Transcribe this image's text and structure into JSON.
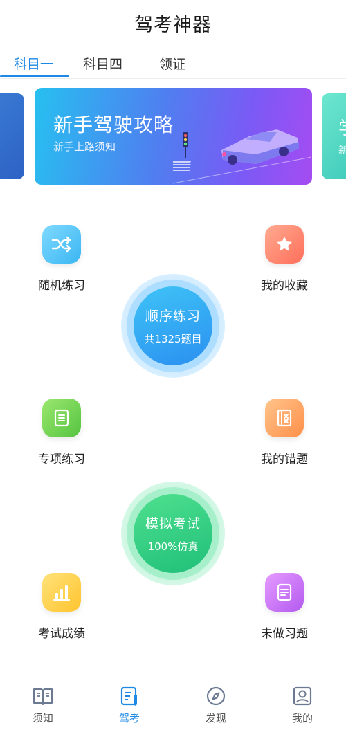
{
  "header": {
    "title": "驾考神器"
  },
  "tabs": [
    {
      "label": "科目一",
      "active": true
    },
    {
      "label": "科目四",
      "active": false
    },
    {
      "label": "领证",
      "active": false
    }
  ],
  "banner": {
    "title": "新手驾驶攻略",
    "subtitle": "新手上路须知",
    "next_peek_title": "学",
    "next_peek_subtitle": "新"
  },
  "features": {
    "random_practice": {
      "label": "随机练习",
      "icon": "shuffle-icon",
      "color": "#4fc3f7"
    },
    "my_favorites": {
      "label": "我的收藏",
      "icon": "star-icon",
      "color": "#ff8a65"
    },
    "topic_practice": {
      "label": "专项练习",
      "icon": "scroll-list-icon",
      "color": "#7ed957"
    },
    "my_mistakes": {
      "label": "我的错题",
      "icon": "mistake-book-icon",
      "color": "#ffa26b"
    },
    "exam_scores": {
      "label": "考试成绩",
      "icon": "bar-chart-icon",
      "color": "#ffd54f"
    },
    "undone_questions": {
      "label": "未做习题",
      "icon": "document-icon",
      "color": "#c06cf0"
    }
  },
  "sequential_practice": {
    "title": "顺序练习",
    "subtitle": "共1325题目"
  },
  "mock_exam": {
    "title": "模拟考试",
    "subtitle": "100%仿真"
  },
  "bottom_nav": [
    {
      "label": "须知",
      "icon": "book-icon",
      "active": false
    },
    {
      "label": "驾考",
      "icon": "quiz-pen-icon",
      "active": true
    },
    {
      "label": "发现",
      "icon": "compass-icon",
      "active": false
    },
    {
      "label": "我的",
      "icon": "profile-icon",
      "active": false
    }
  ],
  "colors": {
    "accent": "#1e88e5"
  }
}
